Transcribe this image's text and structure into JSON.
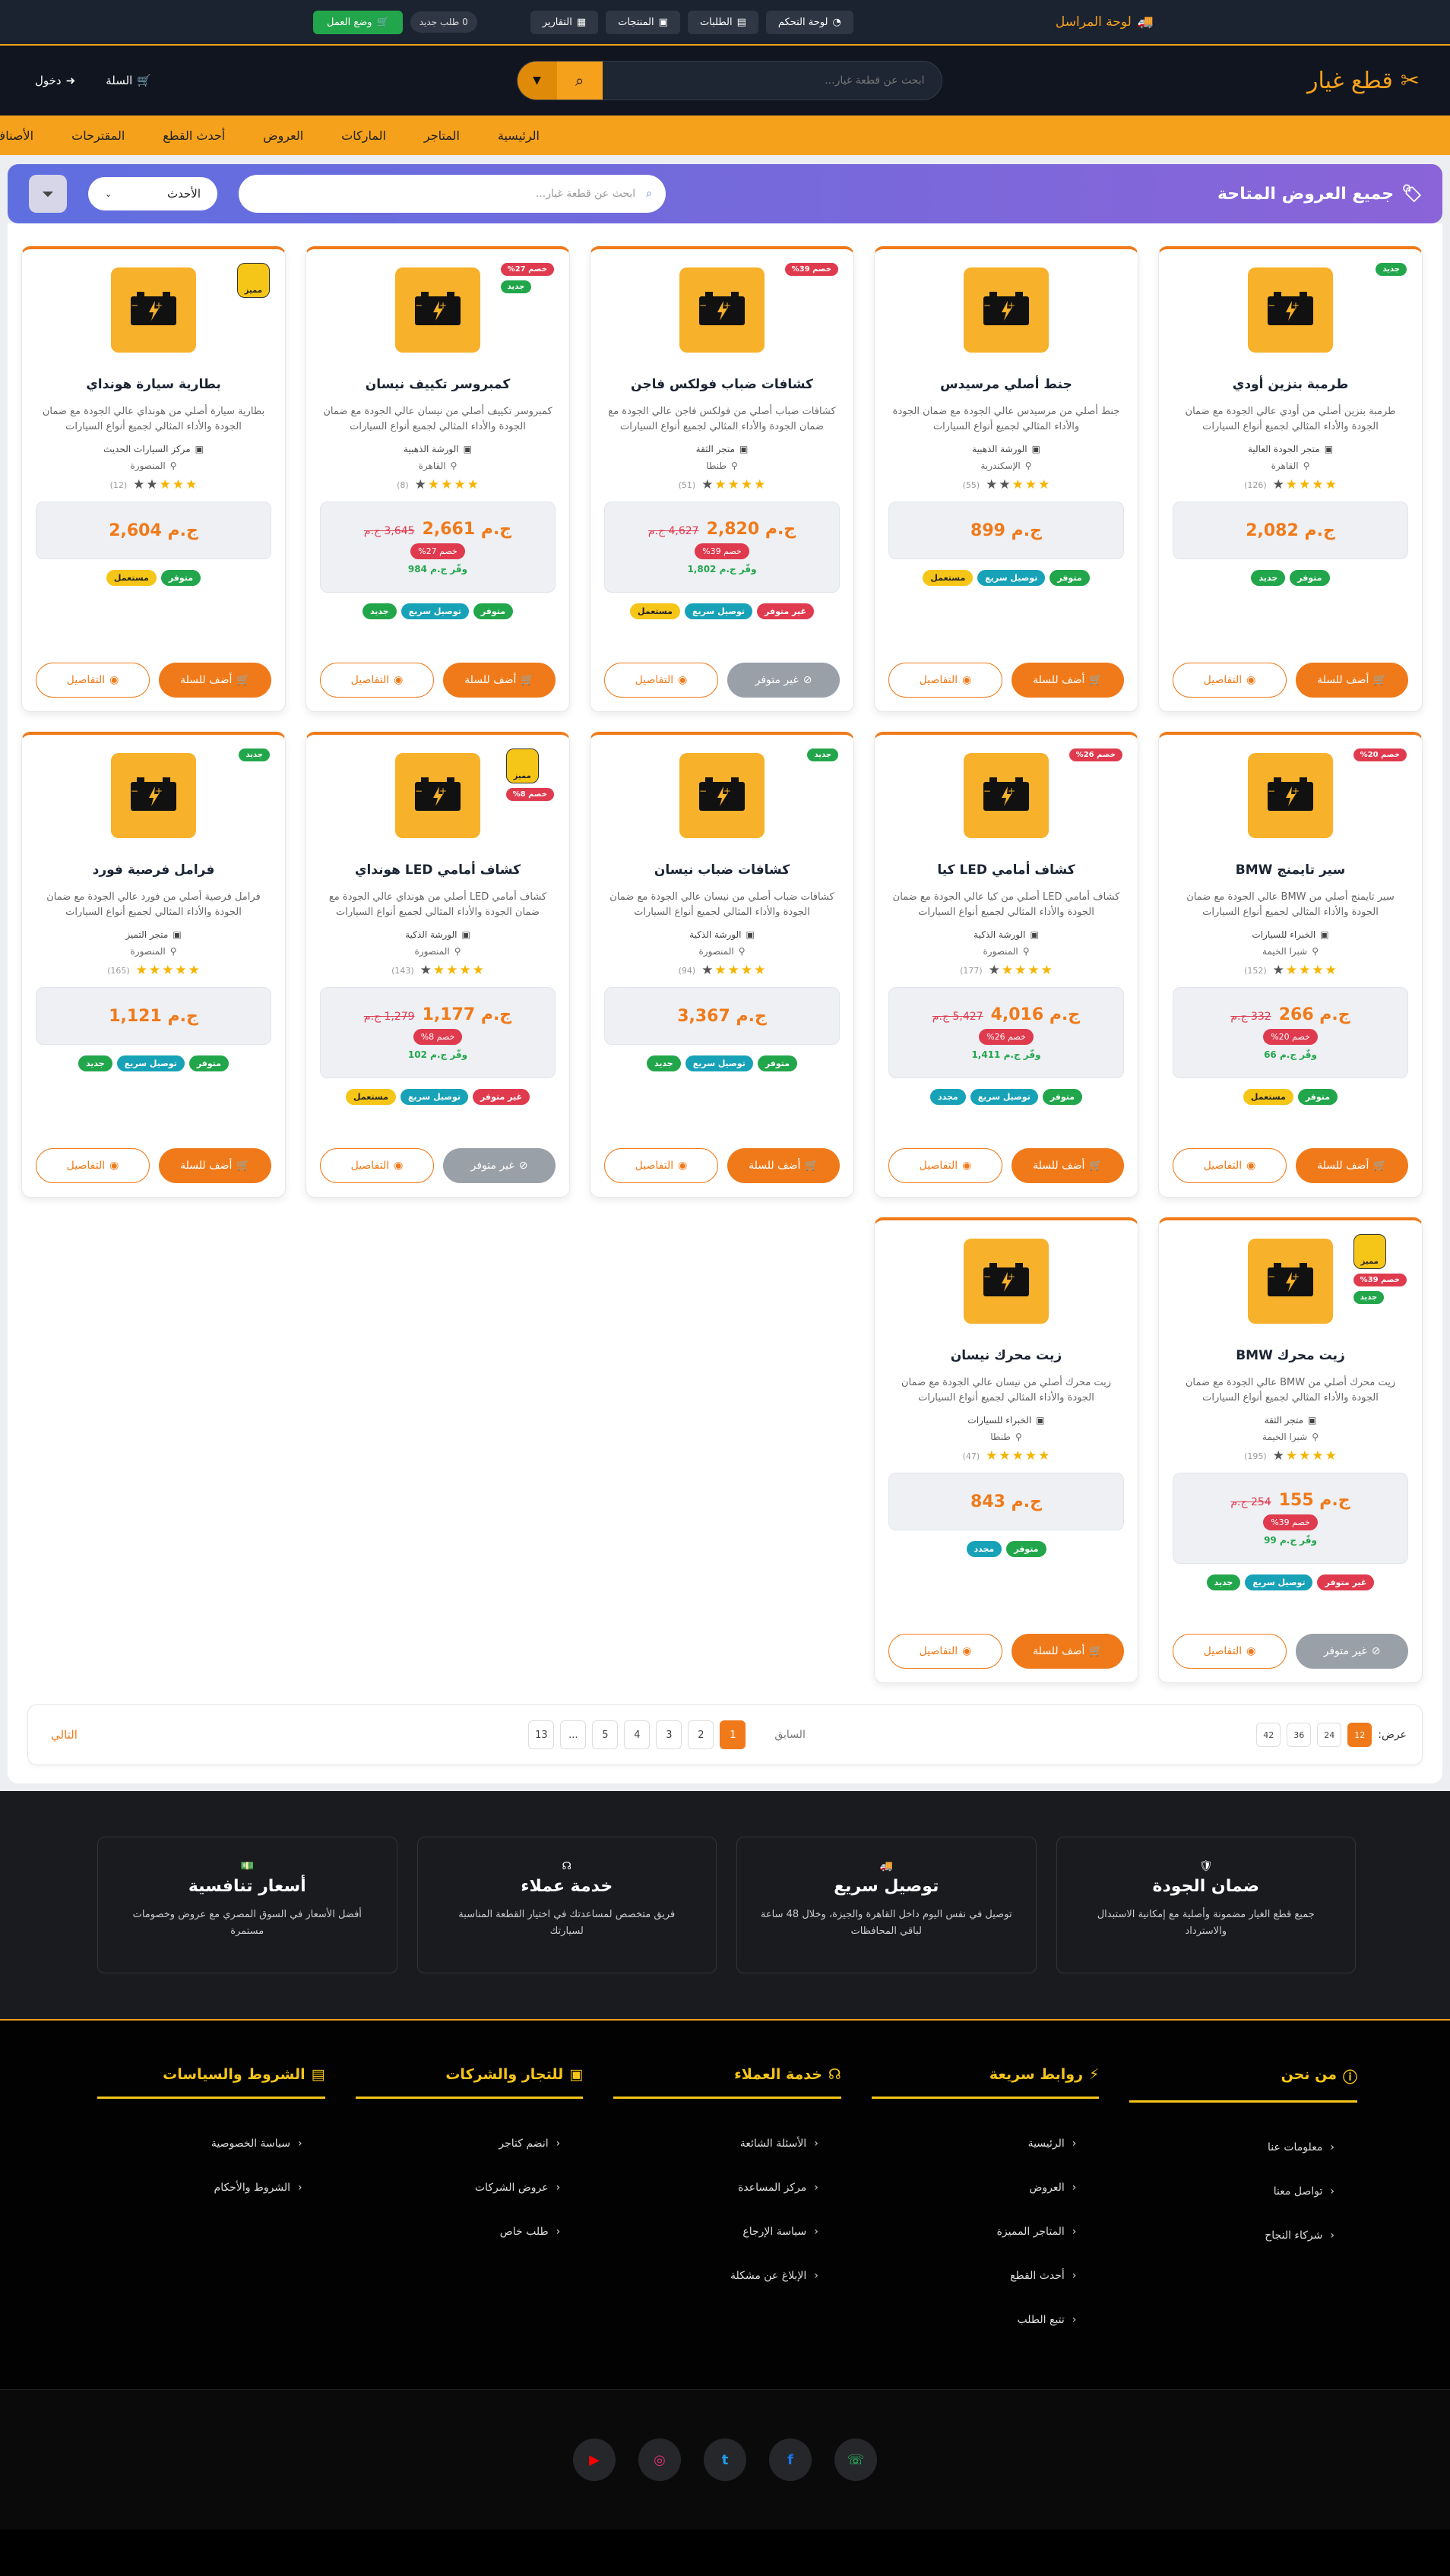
{
  "topbar": {
    "title": "لوحة المراسل",
    "dashboard": "لوحة التحكم",
    "orders": "الطلبات",
    "products": "المنتجات",
    "reports": "التقارير",
    "new_orders": "0 طلب جديد",
    "work_mode": "وضع العمل"
  },
  "header": {
    "logo": "قطع غيار",
    "search_placeholder": "ابحث عن قطعة غيار...",
    "cart": "السلة",
    "login": "دخول"
  },
  "nav": [
    "الرئيسية",
    "المتاجر",
    "الماركات",
    "العروض",
    "أحدث القطع",
    "المقترحات",
    "الأصناف"
  ],
  "banner": {
    "title": "جميع العروض المتاحة",
    "search_placeholder": "ابحث عن قطعة غيار...",
    "sort": "الأحدث"
  },
  "labels": {
    "add": "أضف للسلة",
    "na": "غير متوفر",
    "details": "التفاصيل",
    "currency": "ج.م",
    "save_prefix": "وفّر"
  },
  "products": [
    {
      "name": "طرمبة بنزين أودي",
      "desc": "طرمبة بنزين أصلي من أودي عالي الجودة مع ضمان الجودة والأداء المثالي لجميع أنواع السيارات",
      "store": "متجر الجودة العالية",
      "loc": "القاهرة",
      "stars": 4,
      "count": "(126)",
      "price": "2,082",
      "old": "",
      "disc": "",
      "save": "",
      "badges": [
        {
          "t": "جديد",
          "c": "new"
        }
      ],
      "tags": [
        {
          "t": "متوفر",
          "c": "green"
        },
        {
          "t": "جديد",
          "c": "green"
        }
      ],
      "avail": true
    },
    {
      "name": "جنط أصلي مرسيدس",
      "desc": "جنط أصلي من مرسيدس عالي الجودة مع ضمان الجودة والأداء المثالي لجميع أنواع السيارات",
      "store": "الورشة الذهبية",
      "loc": "الإسكندرية",
      "stars": 3,
      "count": "(55)",
      "price": "899",
      "old": "",
      "disc": "",
      "save": "",
      "badges": [],
      "tags": [
        {
          "t": "متوفر",
          "c": "green"
        },
        {
          "t": "توصيل سريع",
          "c": "blue"
        },
        {
          "t": "مستعمل",
          "c": "yellow"
        }
      ],
      "avail": true
    },
    {
      "name": "كشافات ضباب فولكس فاجن",
      "desc": "كشافات ضباب أصلي من فولكس فاجن عالي الجودة مع ضمان الجودة والأداء المثالي لجميع أنواع السيارات",
      "store": "متجر الثقة",
      "loc": "طنطا",
      "stars": 4,
      "count": "(51)",
      "price": "2,820",
      "old": "4,627",
      "disc": "خصم 39%",
      "save": "وفّر ج.م 1,802",
      "badges": [
        {
          "t": "خصم 39%",
          "c": "disc"
        }
      ],
      "tags": [
        {
          "t": "غير متوفر",
          "c": "red"
        },
        {
          "t": "توصيل سريع",
          "c": "blue"
        },
        {
          "t": "مستعمل",
          "c": "yellow"
        }
      ],
      "avail": false
    },
    {
      "name": "كمبروسر تكييف نيسان",
      "desc": "كمبروسر تكييف أصلي من نيسان عالي الجودة مع ضمان الجودة والأداء المثالي لجميع أنواع السيارات",
      "store": "الورشة الذهبية",
      "loc": "القاهرة",
      "stars": 4,
      "count": "(8)",
      "price": "2,661",
      "old": "3,645",
      "disc": "خصم 27%",
      "save": "وفّر ج.م 984",
      "badges": [
        {
          "t": "خصم 27%",
          "c": "disc"
        },
        {
          "t": "جديد",
          "c": "new"
        }
      ],
      "tags": [
        {
          "t": "متوفر",
          "c": "green"
        },
        {
          "t": "توصيل سريع",
          "c": "blue"
        },
        {
          "t": "جديد",
          "c": "green"
        }
      ],
      "avail": true
    },
    {
      "name": "بطارية سيارة هونداي",
      "desc": "بطارية سيارة أصلي من هونداي عالي الجودة مع ضمان الجودة والأداء المثالي لجميع أنواع السيارات",
      "store": "مركز السيارات الحديث",
      "loc": "المنصورة",
      "stars": 3,
      "count": "(12)",
      "price": "2,604",
      "old": "",
      "disc": "",
      "save": "",
      "badges": [
        {
          "t": "مميز",
          "c": "feat"
        }
      ],
      "tags": [
        {
          "t": "متوفر",
          "c": "green"
        },
        {
          "t": "مستعمل",
          "c": "yellow"
        }
      ],
      "avail": true
    },
    {
      "name": "سير تايمنج BMW",
      "desc": "سير تايمنج أصلي من BMW عالي الجودة مع ضمان الجودة والأداء المثالي لجميع أنواع السيارات",
      "store": "الخبراء للسيارات",
      "loc": "شبرا الخيمة",
      "stars": 4,
      "count": "(152)",
      "price": "266",
      "old": "332",
      "disc": "خصم 20%",
      "save": "وفّر ج.م 66",
      "badges": [
        {
          "t": "خصم 20%",
          "c": "disc"
        }
      ],
      "tags": [
        {
          "t": "متوفر",
          "c": "green"
        },
        {
          "t": "مستعمل",
          "c": "yellow"
        }
      ],
      "avail": true
    },
    {
      "name": "كشاف أمامي LED كيا",
      "desc": "كشاف أمامي LED أصلي من كيا عالي الجودة مع ضمان الجودة والأداء المثالي لجميع أنواع السيارات",
      "store": "الورشة الذكية",
      "loc": "المنصورة",
      "stars": 4,
      "count": "(177)",
      "price": "4,016",
      "old": "5,427",
      "disc": "خصم 26%",
      "save": "وفّر ج.م 1,411",
      "badges": [
        {
          "t": "خصم 26%",
          "c": "disc"
        }
      ],
      "tags": [
        {
          "t": "متوفر",
          "c": "green"
        },
        {
          "t": "توصيل سريع",
          "c": "blue"
        },
        {
          "t": "مجدد",
          "c": "blue"
        }
      ],
      "avail": true
    },
    {
      "name": "كشافات ضباب نيسان",
      "desc": "كشافات ضباب أصلي من نيسان عالي الجودة مع ضمان الجودة والأداء المثالي لجميع أنواع السيارات",
      "store": "الورشة الذكية",
      "loc": "المنصورة",
      "stars": 4,
      "count": "(94)",
      "price": "3,367",
      "old": "",
      "disc": "",
      "save": "",
      "badges": [
        {
          "t": "جديد",
          "c": "new"
        }
      ],
      "tags": [
        {
          "t": "متوفر",
          "c": "green"
        },
        {
          "t": "توصيل سريع",
          "c": "blue"
        },
        {
          "t": "جديد",
          "c": "green"
        }
      ],
      "avail": true
    },
    {
      "name": "كشاف أمامي LED هونداي",
      "desc": "كشاف أمامي LED أصلي من هونداي عالي الجودة مع ضمان الجودة والأداء المثالي لجميع أنواع السيارات",
      "store": "الورشة الذكية",
      "loc": "المنصورة",
      "stars": 4,
      "count": "(143)",
      "price": "1,177",
      "old": "1,279",
      "disc": "خصم 8%",
      "save": "وفّر ج.م 102",
      "badges": [
        {
          "t": "مميز",
          "c": "feat"
        },
        {
          "t": "خصم 8%",
          "c": "disc"
        }
      ],
      "tags": [
        {
          "t": "غير متوفر",
          "c": "red"
        },
        {
          "t": "توصيل سريع",
          "c": "blue"
        },
        {
          "t": "مستعمل",
          "c": "yellow"
        }
      ],
      "avail": false
    },
    {
      "name": "فرامل فرصية فورد",
      "desc": "فرامل فرصية أصلي من فورد عالي الجودة مع ضمان الجودة والأداء المثالي لجميع أنواع السيارات",
      "store": "متجر التميز",
      "loc": "المنصورة",
      "stars": 5,
      "count": "(165)",
      "price": "1,121",
      "old": "",
      "disc": "",
      "save": "",
      "badges": [
        {
          "t": "جديد",
          "c": "new"
        }
      ],
      "tags": [
        {
          "t": "متوفر",
          "c": "green"
        },
        {
          "t": "توصيل سريع",
          "c": "blue"
        },
        {
          "t": "جديد",
          "c": "green"
        }
      ],
      "avail": true
    },
    {
      "name": "زيت محرك BMW",
      "desc": "زيت محرك أصلي من BMW عالي الجودة مع ضمان الجودة والأداء المثالي لجميع أنواع السيارات",
      "store": "متجر الثقة",
      "loc": "شبرا الخيمة",
      "stars": 4,
      "count": "(195)",
      "price": "155",
      "old": "254",
      "disc": "خصم 39%",
      "save": "وفّر ج.م 99",
      "badges": [
        {
          "t": "مميز",
          "c": "feat"
        },
        {
          "t": "خصم 39%",
          "c": "disc"
        },
        {
          "t": "جديد",
          "c": "new"
        }
      ],
      "tags": [
        {
          "t": "غير متوفر",
          "c": "red"
        },
        {
          "t": "توصيل سريع",
          "c": "blue"
        },
        {
          "t": "جديد",
          "c": "green"
        }
      ],
      "avail": false
    },
    {
      "name": "زيت محرك نيسان",
      "desc": "زيت محرك أصلي من نيسان عالي الجودة مع ضمان الجودة والأداء المثالي لجميع أنواع السيارات",
      "store": "الخبراء للسيارات",
      "loc": "طنطا",
      "stars": 5,
      "count": "(47)",
      "price": "843",
      "old": "",
      "disc": "",
      "save": "",
      "badges": [],
      "tags": [
        {
          "t": "متوفر",
          "c": "green"
        },
        {
          "t": "مجدد",
          "c": "blue"
        }
      ],
      "avail": true
    }
  ],
  "pagination": {
    "show": "عرض:",
    "sizes": [
      "12",
      "24",
      "36",
      "42"
    ],
    "prev": "السابق",
    "pages": [
      "1",
      "2",
      "3",
      "4",
      "5",
      "...",
      "13"
    ],
    "next": "التالي"
  },
  "features": [
    {
      "title": "ضمان الجودة",
      "text": "جميع قطع الغيار مضمونة وأصلية مع إمكانية الاستبدال والاسترداد"
    },
    {
      "title": "توصيل سريع",
      "text": "توصيل في نفس اليوم داخل القاهرة والجيزة، وخلال 48 ساعة لباقي المحافظات"
    },
    {
      "title": "خدمة عملاء",
      "text": "فريق متخصص لمساعدتك في اختيار القطعة المناسبة لسيارتك"
    },
    {
      "title": "أسعار تنافسية",
      "text": "أفضل الأسعار في السوق المصري مع عروض وخصومات مستمرة"
    }
  ],
  "footer": [
    {
      "title": "من نحن",
      "items": [
        "معلومات عنا",
        "تواصل معنا",
        "شركاء النجاح"
      ]
    },
    {
      "title": "روابط سريعة",
      "items": [
        "الرئيسية",
        "العروض",
        "المتاجر المميزة",
        "أحدث القطع",
        "تتبع الطلب"
      ]
    },
    {
      "title": "خدمة العملاء",
      "items": [
        "الأسئلة الشائعة",
        "مركز المساعدة",
        "سياسة الإرجاع",
        "الإبلاغ عن مشكلة"
      ]
    },
    {
      "title": "للتجار والشركات",
      "items": [
        "انضم كتاجر",
        "عروض الشركات",
        "طلب خاص"
      ]
    },
    {
      "title": "الشروط والسياسات",
      "items": [
        "سياسة الخصوصية",
        "الشروط والأحكام"
      ]
    }
  ],
  "social": [
    {
      "name": "whatsapp-icon",
      "glyph": "☏",
      "color": "#25d366"
    },
    {
      "name": "facebook-icon",
      "glyph": "f",
      "color": "#1877f2"
    },
    {
      "name": "twitter-icon",
      "glyph": "t",
      "color": "#1da1f2"
    },
    {
      "name": "instagram-icon",
      "glyph": "◎",
      "color": "#e1306c"
    },
    {
      "name": "youtube-icon",
      "glyph": "▶",
      "color": "#ff0000"
    }
  ]
}
